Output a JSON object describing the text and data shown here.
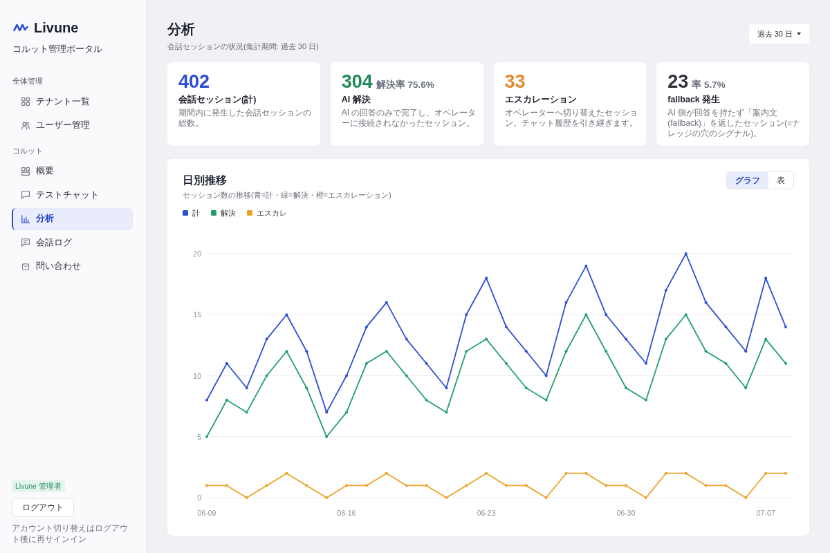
{
  "sidebar": {
    "brand": "Livune",
    "subtitle": "コルット管理ポータル",
    "sections": [
      {
        "heading": "全体管理",
        "items": [
          {
            "label": "テナント一覧",
            "kind": "grid",
            "selected": false
          },
          {
            "label": "ユーザー管理",
            "kind": "users",
            "selected": false
          }
        ]
      },
      {
        "heading": "コルット",
        "items": [
          {
            "label": "概要",
            "kind": "layout",
            "selected": false
          },
          {
            "label": "テストチャット",
            "kind": "bubble",
            "selected": false
          },
          {
            "label": "分析",
            "kind": "bars",
            "selected": true
          },
          {
            "label": "会話ログ",
            "kind": "lines",
            "selected": false
          },
          {
            "label": "問い合わせ",
            "kind": "mail",
            "selected": false
          }
        ]
      }
    ],
    "role_badge": "Livune 管理者",
    "logout_button": "ログアウト",
    "note": "アカウント切り替えはログアウト後に再サインイン"
  },
  "header": {
    "title": "分析",
    "subtitle": "会話セッションの状況(集計期間: 過去 30 日)",
    "period_dropdown": "過去 30 日"
  },
  "stat_cards": [
    {
      "value": "402",
      "color": "#2a4bd4",
      "label": "会話セッション(計)",
      "description": "期間内に発生した会話セッションの総数。"
    },
    {
      "value": "304",
      "rate": "解決率 75.6%",
      "color": "#1f8a57",
      "label": "AI 解決",
      "description": "AI の回答のみで完了し、オペレーターに接続されなかったセッション。"
    },
    {
      "value": "33",
      "color": "#e0892b",
      "label": "エスカレーション",
      "description": "オペレーターへ切り替えたセッション。チャット履歴を引き継ぎます。"
    },
    {
      "value": "23",
      "rate": "率 5.7%",
      "color": "#2e313b",
      "label": "fallback 発生",
      "description": "AI 側が回答を持たず「案内文(fallback)」を返したセッション(=ナレッジの穴のシグナル)。"
    }
  ],
  "daily_trend": {
    "title": "日別推移",
    "subtitle": "セッション数の推移(青=計・緑=解決・橙=エスカレーション)",
    "view_toggle": [
      {
        "label": "グラフ",
        "selected": true
      },
      {
        "label": "表",
        "selected": false
      }
    ],
    "chart_data": {
      "type": "line",
      "legend": "top",
      "grid": true,
      "categories": [
        "06-09",
        null,
        null,
        null,
        null,
        null,
        null,
        "06-16",
        null,
        null,
        null,
        null,
        null,
        null,
        "06-23",
        null,
        null,
        null,
        null,
        null,
        null,
        "06-30",
        null,
        null,
        null,
        null,
        null,
        null,
        "07-07",
        null
      ],
      "series": [
        {
          "name": "計",
          "color": "#2e4fd4",
          "values": [
            8,
            11,
            9,
            13,
            15,
            12,
            7,
            10,
            14,
            16,
            13,
            11,
            9,
            15,
            18,
            14,
            12,
            10,
            16,
            19,
            15,
            13,
            11,
            17,
            20,
            16,
            14,
            12,
            18,
            14
          ]
        },
        {
          "name": "解決",
          "color": "#22a06c",
          "values": [
            5,
            8,
            7,
            10,
            12,
            9,
            5,
            7,
            11,
            12,
            10,
            8,
            7,
            12,
            13,
            11,
            9,
            8,
            12,
            15,
            12,
            9,
            8,
            13,
            15,
            12,
            11,
            9,
            13,
            11
          ]
        },
        {
          "name": "エスカレ",
          "color": "#eea224",
          "values": [
            1,
            1,
            0,
            1,
            2,
            1,
            0,
            1,
            1,
            2,
            1,
            1,
            0,
            1,
            2,
            1,
            1,
            0,
            2,
            2,
            1,
            1,
            0,
            2,
            2,
            1,
            1,
            0,
            2,
            2
          ]
        }
      ],
      "ylim": [
        0,
        20
      ],
      "yticks": [
        0,
        5,
        10,
        15,
        20
      ]
    }
  }
}
